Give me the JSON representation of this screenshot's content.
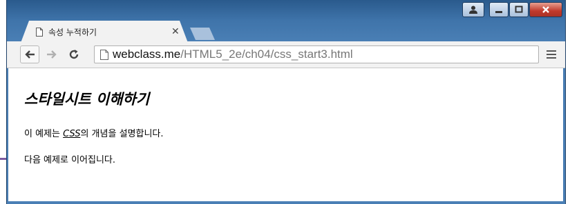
{
  "browser": {
    "tab": {
      "title": "속성 누적하기"
    },
    "address_bar": {
      "host": "webclass.me",
      "path": "/HTML5_2e/ch04/css_start3.html"
    }
  },
  "page": {
    "heading": "스타일시트 이해하기",
    "paragraph1": {
      "before": "이 예제는 ",
      "emphasis": "CSS",
      "after": "의 개념을 설명합니다."
    },
    "paragraph2": "다음 예제로 이어집니다."
  },
  "colors": {
    "frame_blue": "#3f74aa",
    "close_red": "#c0392b"
  }
}
